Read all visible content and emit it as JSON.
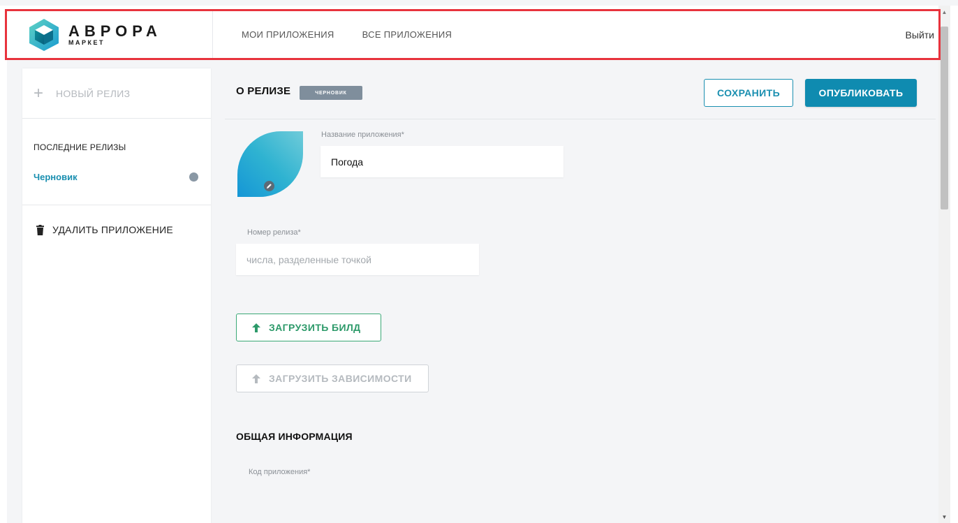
{
  "header": {
    "logo": {
      "main": "АВРОРА",
      "sub": "МАРКЕТ"
    },
    "nav": [
      {
        "label": "МОИ ПРИЛОЖЕНИЯ"
      },
      {
        "label": "ВСЕ ПРИЛОЖЕНИЯ"
      }
    ],
    "logout_label": "Выйти"
  },
  "sidebar": {
    "new_release_label": "НОВЫЙ РЕЛИЗ",
    "recent_title": "ПОСЛЕДНИЕ РЕЛИЗЫ",
    "draft_label": "Черновик",
    "delete_label": "УДАЛИТЬ ПРИЛОЖЕНИЕ"
  },
  "content": {
    "title": "О РЕЛИЗЕ",
    "badge": "ЧЕРНОВИК",
    "save_label": "СОХРАНИТЬ",
    "publish_label": "ОПУБЛИКОВАТЬ",
    "app_name_label": "Название приложения*",
    "app_name_value": "Погода",
    "release_number_label": "Номер релиза*",
    "release_number_placeholder": "числа, разделенные точкой",
    "upload_build_label": "ЗАГРУЗИТЬ БИЛД",
    "upload_deps_label": "ЗАГРУЗИТЬ ЗАВИСИМОСТИ",
    "general_info_title": "ОБЩАЯ ИНФОРМАЦИЯ",
    "app_code_label": "Код приложения*"
  },
  "colors": {
    "accent": "#0f8bb0",
    "upload_green": "#3aa876",
    "highlight_border": "#e8333d",
    "badge_bg": "#7f8e9c"
  },
  "icons": {
    "logo": "aurora-cube-logo",
    "new_release": "plus-icon",
    "draft_status": "status-dot-icon",
    "delete": "trash-icon",
    "edit": "pencil-icon",
    "upload": "arrow-up-icon"
  }
}
